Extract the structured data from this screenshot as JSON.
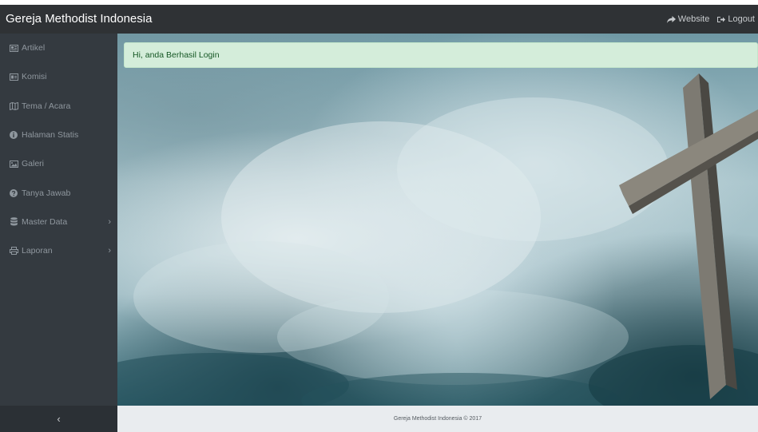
{
  "header": {
    "brand": "Gereja Methodist Indonesia",
    "links": [
      {
        "label": "Website",
        "icon": "share-icon"
      },
      {
        "label": "Logout",
        "icon": "sign-out-icon"
      }
    ]
  },
  "sidebar": {
    "items": [
      {
        "label": "Artikel",
        "icon": "newspaper-icon"
      },
      {
        "label": "Komisi",
        "icon": "id-card-icon"
      },
      {
        "label": "Tema / Acara",
        "icon": "map-icon"
      },
      {
        "label": "Halaman Statis",
        "icon": "info-circle-icon"
      },
      {
        "label": "Galeri",
        "icon": "image-icon"
      },
      {
        "label": "Tanya Jawab",
        "icon": "question-circle-icon"
      },
      {
        "label": "Master Data",
        "icon": "database-icon",
        "chevron": "›"
      },
      {
        "label": "Laporan",
        "icon": "print-icon",
        "chevron": "›"
      }
    ],
    "toggle": "‹"
  },
  "alert": {
    "message": "Hi, anda Berhasil Login"
  },
  "footer": {
    "text": "Gereja Methodist Indonesia © 2017"
  },
  "colors": {
    "topbar": "#2f3235",
    "sidebar": "#343a40",
    "alert_bg": "#d4edda",
    "alert_text": "#155724",
    "footer_bg": "#e9ecef"
  }
}
